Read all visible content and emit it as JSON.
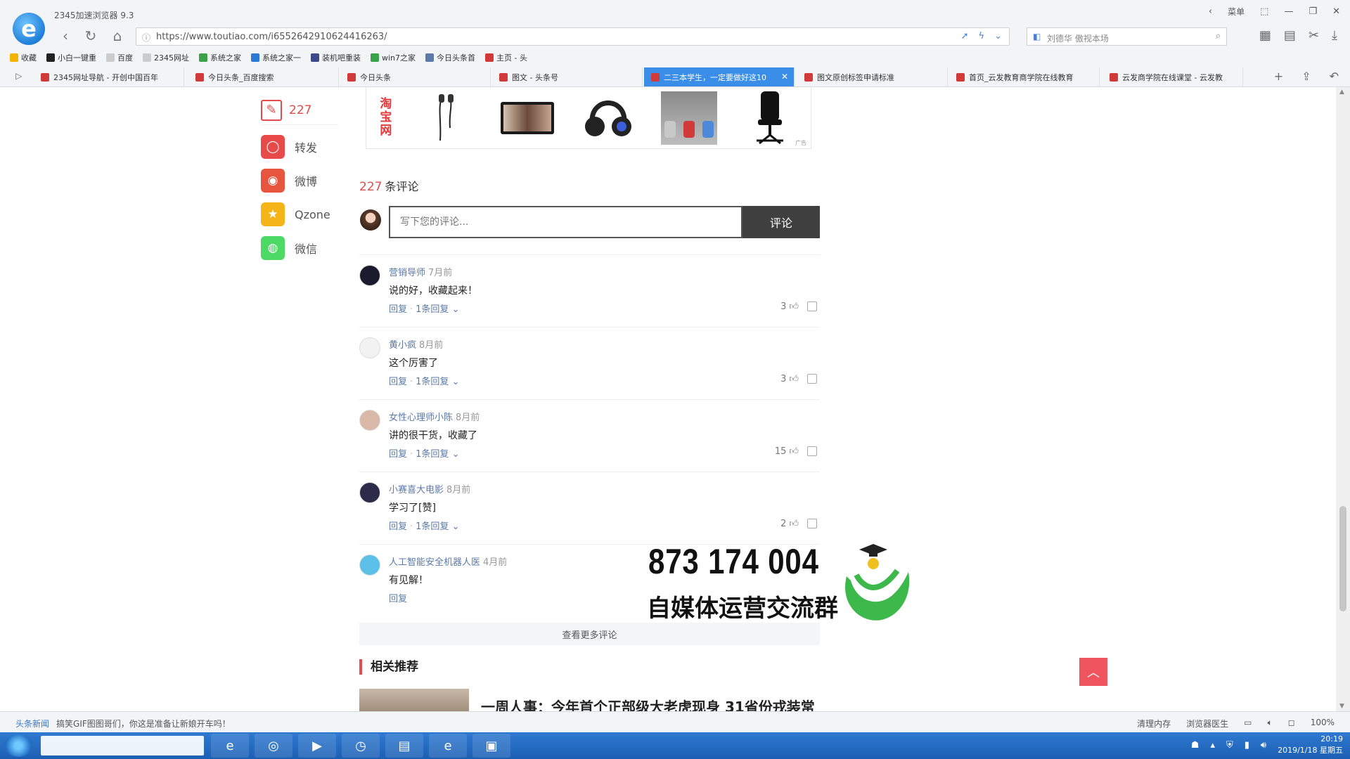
{
  "window": {
    "app_title": "2345加速浏览器 9.3",
    "menu_label": "菜单"
  },
  "address_bar": {
    "url": "https://www.toutiao.com/i6552642910624416263/",
    "search_placeholder": "刘德华 傲视本场"
  },
  "bookmarks": [
    {
      "label": "收藏",
      "color": "#f2b400"
    },
    {
      "label": "小白一键重",
      "color": "#222222"
    },
    {
      "label": "百度",
      "color": "#cccccc"
    },
    {
      "label": "2345网址",
      "color": "#cccccc"
    },
    {
      "label": "系统之家",
      "color": "#3aa34a"
    },
    {
      "label": "系统之家一",
      "color": "#2b7ad6"
    },
    {
      "label": "装机吧重装",
      "color": "#3a4a8a"
    },
    {
      "label": "win7之家",
      "color": "#3aa34a"
    },
    {
      "label": "今日头条首",
      "color": "#5b7aa8"
    },
    {
      "label": "主页 - 头",
      "color": "#d23a3a"
    }
  ],
  "tabs": [
    {
      "label": "2345网址导航 - 开创中国百年"
    },
    {
      "label": "今日头条_百度搜索"
    },
    {
      "label": "今日头条"
    },
    {
      "label": "图文 - 头条号"
    },
    {
      "label": "二三本学生，一定要做好这10"
    },
    {
      "label": "图文原创标签申请标准"
    },
    {
      "label": "首页_云发教育商学院在线教育"
    },
    {
      "label": "云发商学院在线课堂 - 云发教"
    }
  ],
  "share": {
    "comment_count": "227",
    "items": [
      {
        "label": "转发",
        "color": "#e84a4a"
      },
      {
        "label": "微博",
        "color": "#e8553e"
      },
      {
        "label": "Qzone",
        "color": "#f5b417"
      },
      {
        "label": "微信",
        "color": "#4cd964"
      }
    ]
  },
  "ads": {
    "taobao_text": [
      "淘",
      "宝",
      "网"
    ],
    "ad_label": "广告"
  },
  "comments_section": {
    "count": "227",
    "title_suffix": "条评论",
    "input_placeholder": "写下您的评论...",
    "submit_label": "评论",
    "more_label": "查看更多评论",
    "items": [
      {
        "user": "营销导师",
        "time": "7月前",
        "text": "说的好，收藏起来！",
        "reply": "回复",
        "replies": "1条回复",
        "likes": "3",
        "avatar_color": "#1b1b2e"
      },
      {
        "user": "黄小疯",
        "time": "8月前",
        "text": "这个厉害了",
        "reply": "回复",
        "replies": "1条回复",
        "likes": "3",
        "avatar_color": "#f2f2f2"
      },
      {
        "user": "女性心理师小陈",
        "time": "8月前",
        "text": "讲的很干货，收藏了",
        "reply": "回复",
        "replies": "1条回复",
        "likes": "15",
        "avatar_color": "#d9b8a8"
      },
      {
        "user": "小赛喜大电影",
        "time": "8月前",
        "text": "学习了[赞]",
        "reply": "回复",
        "replies": "1条回复",
        "likes": "2",
        "avatar_color": "#2e2a4a"
      },
      {
        "user": "人工智能安全机器人医",
        "time": "4月前",
        "text": "有见解！",
        "reply": "回复",
        "replies": "",
        "likes": "",
        "avatar_color": "#5ac0e8"
      }
    ]
  },
  "related": {
    "title": "相关推荐",
    "headline": "一周人事：今年首个正部级大老虎现身 31省份戎装常"
  },
  "promo": {
    "number": "873 174 004",
    "text": "自媒体运营交流群"
  },
  "status_bar": {
    "news_label": "头条新闻",
    "news_text": "搞笑GIF图图哥们，你这是准备让新娘开车吗！",
    "clear_memory": "清理内存",
    "browser_doctor": "浏览器医生",
    "zoom": "100%"
  },
  "taskbar": {
    "time": "20:19",
    "date": "2019/1/18 星期五"
  }
}
